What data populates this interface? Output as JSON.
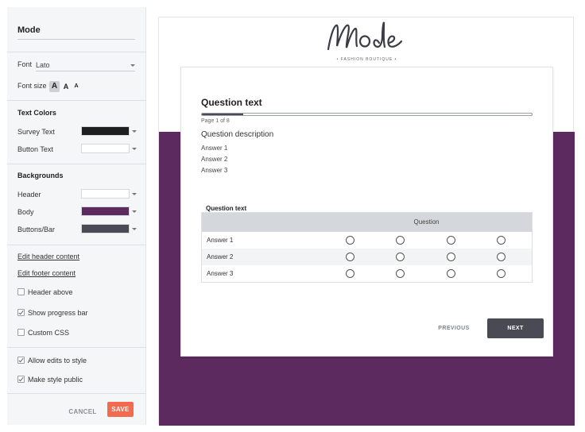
{
  "sidebar": {
    "title": "Mode",
    "font_label": "Font",
    "font_value": "Lato",
    "font_size_label": "Font size",
    "font_size_options": [
      "A",
      "A",
      "A"
    ],
    "text_colors_heading": "Text Colors",
    "survey_text_label": "Survey Text",
    "survey_text_color": "#1e1e1e",
    "button_text_label": "Button Text",
    "button_text_color": "#ffffff",
    "backgrounds_heading": "Backgrounds",
    "header_label": "Header",
    "header_color": "#ffffff",
    "body_label": "Body",
    "body_color": "#5c2a5e",
    "buttons_bar_label": "Buttons/Bar",
    "buttons_bar_color": "#4a4a55",
    "edit_header_link": "Edit header content",
    "edit_footer_link": "Edit footer content",
    "header_above_label": "Header above",
    "header_above_checked": false,
    "show_progress_label": "Show progress bar",
    "show_progress_checked": true,
    "custom_css_label": "Custom CSS",
    "custom_css_checked": false,
    "allow_edits_label": "Allow edits to style",
    "allow_edits_checked": true,
    "make_public_label": "Make style public",
    "make_public_checked": true,
    "cancel_label": "CANCEL",
    "save_label": "SAVE"
  },
  "preview": {
    "logo_text": "Mode",
    "logo_subtitle": "• FASHION BOUTIQUE •",
    "question_title": "Question text",
    "progress": 0.125,
    "page_indicator": "Page 1 of 8",
    "question_description": "Question description",
    "answers": [
      "Answer 1",
      "Answer 2",
      "Answer 3"
    ],
    "matrix": {
      "title": "Question text",
      "column_header": "Question",
      "rows": [
        "Answer 1",
        "Answer 2",
        "Answer 3"
      ],
      "columns_count": 4
    },
    "previous_label": "PREVIOUS",
    "next_label": "NEXT"
  }
}
